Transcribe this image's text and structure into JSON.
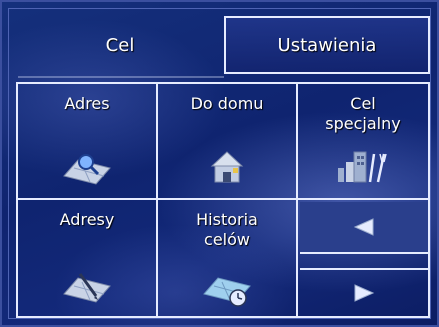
{
  "tabs": [
    {
      "label": "Cel",
      "selected": true
    },
    {
      "label": "Ustawienia",
      "selected": false
    }
  ],
  "menu": {
    "address": {
      "label": "Adres",
      "icon": "map-search-icon"
    },
    "home": {
      "label": "Do domu",
      "icon": "house-icon"
    },
    "special_line1": "Cel",
    "special_line2": "specjalny",
    "special_icon": "poi-icon",
    "addresses": {
      "label": "Adresy",
      "icon": "map-pen-icon"
    },
    "history_line1": "Historia",
    "history_line2": "celów",
    "history_icon": "history-map-icon"
  },
  "nav": {
    "prev_icon": "arrow-left-icon",
    "next_icon": "arrow-right-icon"
  },
  "colors": {
    "background": "#13297a",
    "border": "#e6ecff",
    "nav_active": "#2a3f8c"
  }
}
